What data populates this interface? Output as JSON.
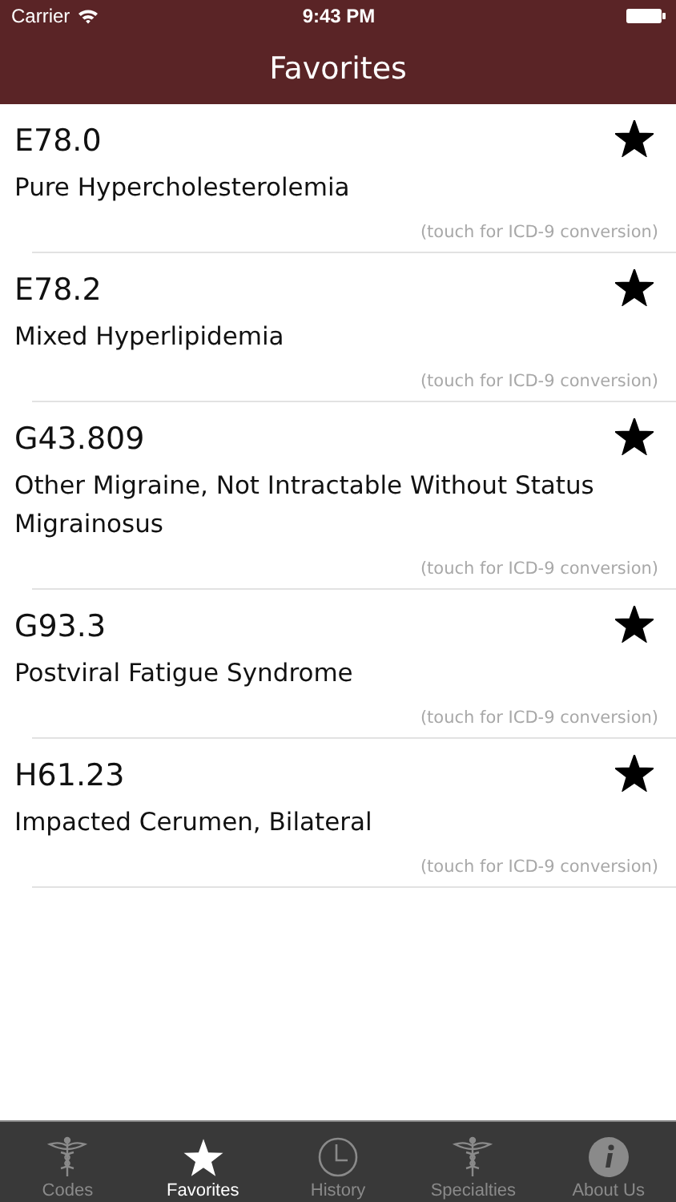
{
  "status_bar": {
    "carrier": "Carrier",
    "time": "9:43 PM"
  },
  "nav_bar": {
    "title": "Favorites"
  },
  "favorites": [
    {
      "code": "E78.0",
      "description": "Pure Hypercholesterolemia",
      "hint": "(touch for ICD-9 conversion)",
      "favorite": true
    },
    {
      "code": "E78.2",
      "description": "Mixed Hyperlipidemia",
      "hint": "(touch for ICD-9 conversion)",
      "favorite": true
    },
    {
      "code": "G43.809",
      "description": "Other Migraine, Not Intractable Without Status Migrainosus",
      "hint": "(touch for ICD-9 conversion)",
      "favorite": true
    },
    {
      "code": "G93.3",
      "description": "Postviral Fatigue Syndrome",
      "hint": "(touch for ICD-9 conversion)",
      "favorite": true
    },
    {
      "code": "H61.23",
      "description": "Impacted Cerumen, Bilateral",
      "hint": "(touch for ICD-9 conversion)",
      "favorite": true
    }
  ],
  "tab_bar": [
    {
      "label": "Codes",
      "kind": "caduceus",
      "selected": false
    },
    {
      "label": "Favorites",
      "kind": "star",
      "selected": true
    },
    {
      "label": "History",
      "kind": "clock",
      "selected": false
    },
    {
      "label": "Specialties",
      "kind": "caduceus",
      "selected": false
    },
    {
      "label": "About Us",
      "kind": "info",
      "selected": false
    }
  ]
}
